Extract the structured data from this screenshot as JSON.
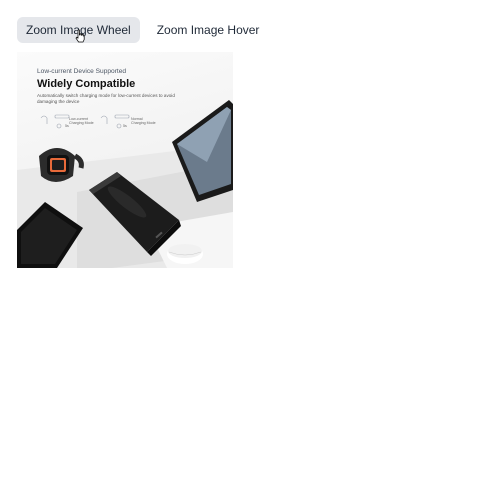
{
  "tabs": [
    {
      "label": "Zoom Image Wheel",
      "active": true
    },
    {
      "label": "Zoom Image Hover",
      "active": false
    }
  ],
  "product_image": {
    "subtitle": "Low-current Device Supported",
    "heading": "Widely Compatible",
    "description": "Automatically switch charging mode for low-current devices to avoid damaging the device",
    "mode_low": "Low-current Charging Mode",
    "mode_normal": "Normal Charging Mode",
    "time_low": "5s",
    "time_normal": "5s"
  },
  "colors": {
    "tab_active_bg": "#e5e7eb",
    "text": "#1f2937"
  }
}
